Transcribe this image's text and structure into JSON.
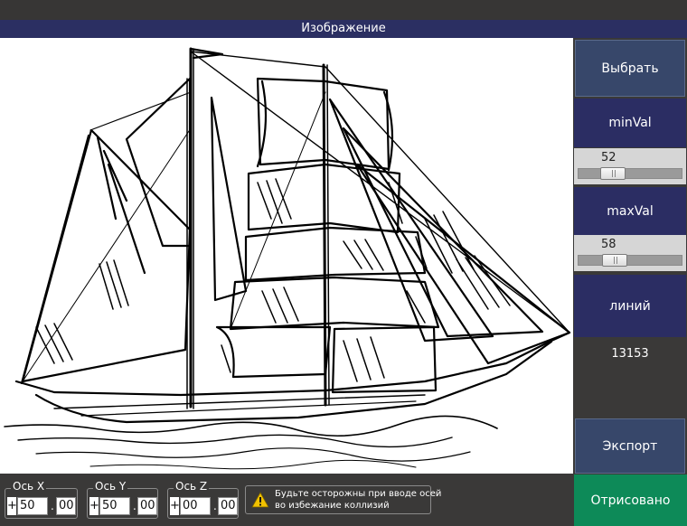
{
  "window": {
    "title": "Изображение"
  },
  "sidebar": {
    "select_label": "Выбрать",
    "minval_label": "minVal",
    "minval_value": "52",
    "minval_fraction": 0.21,
    "maxval_label": "maxVal",
    "maxval_value": "58",
    "maxval_fraction": 0.23,
    "lines_label": "линий",
    "lines_count": "13153",
    "export_label": "Экспорт",
    "status_label": "Отрисовано"
  },
  "axes": [
    {
      "label": "Ось X",
      "sign": "+",
      "int": "50",
      "frac": "00"
    },
    {
      "label": "Ось Y",
      "sign": "+",
      "int": "50",
      "frac": "00"
    },
    {
      "label": "Ось Z",
      "sign": "+",
      "int": "00",
      "frac": "00"
    }
  ],
  "warning": {
    "icon": "warning-icon",
    "line1": "Будьте осторожны при вводе осей",
    "line2": "во избежание коллизий"
  },
  "colors": {
    "title_bar": "#2b2f62",
    "button_blue": "#37476a",
    "label_navy": "#2b2d63",
    "status_green": "#0d8a58"
  }
}
